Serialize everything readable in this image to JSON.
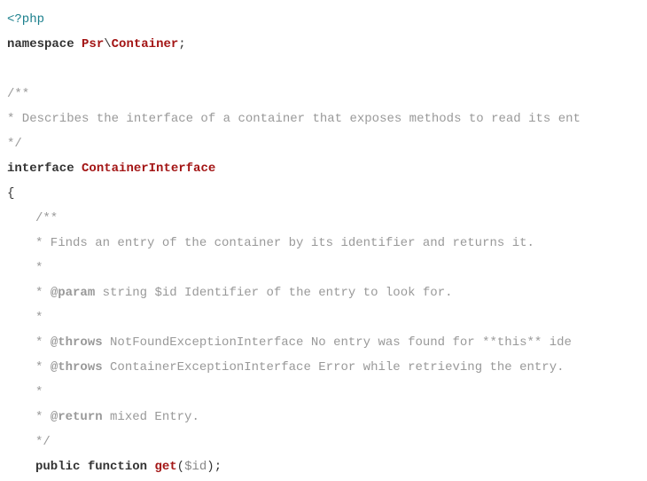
{
  "l1_open": "<?php",
  "l2_kw": "namespace",
  "l2_ns1": "Psr",
  "l2_sep": "\\",
  "l2_ns2": "Container",
  "l2_semi": ";",
  "c1": "/**",
  "c2": " * Describes the interface of a container that exposes methods to read its ent",
  "c3": " */",
  "iface_kw": "interface",
  "iface_name": "ContainerInterface",
  "brace_open": "{",
  "d1": "/**",
  "d2": " * Finds an entry of the container by its identifier and returns it.",
  "d3": " *",
  "d4a": " * ",
  "d4_tag": "@param",
  "d4b": " string $id Identifier of the entry to look for.",
  "d5": " *",
  "d6a": " * ",
  "d6_tag": "@throws",
  "d6b": " NotFoundExceptionInterface  No entry was found for **this** ide",
  "d7a": " * ",
  "d7_tag": "@throws",
  "d7b": " ContainerExceptionInterface Error while retrieving the entry.",
  "d8": " *",
  "d9a": " * ",
  "d9_tag": "@return",
  "d9b": " mixed Entry.",
  "d10": " */",
  "fn_pub": "public",
  "fn_func": "function",
  "fn_name": "get",
  "fn_paren_open": "(",
  "fn_var": "$id",
  "fn_paren_close": ")",
  "fn_semi": ";"
}
